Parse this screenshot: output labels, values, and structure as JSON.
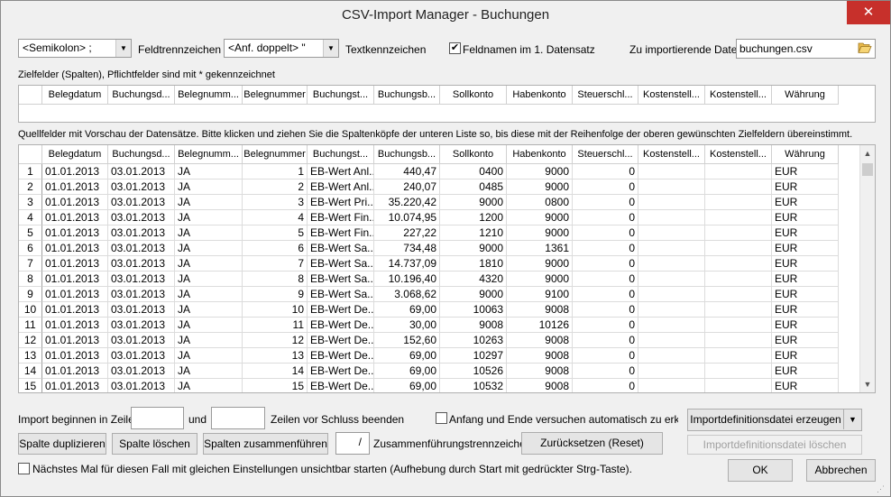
{
  "window": {
    "title": "CSV-Import Manager - Buchungen",
    "close_glyph": "✕"
  },
  "options": {
    "separator_value": "<Semikolon> ;",
    "separator_label": "Feldtrennzeichen",
    "text_value": "<Anf. doppelt> \"",
    "text_label": "Textkennzeichen",
    "fieldnames_checked": true,
    "fieldnames_label": "Feldnamen im 1. Datensatz",
    "file_label": "Zu importierende Datei:",
    "file_value": "buchungen.csv"
  },
  "target": {
    "caption": "Zielfelder (Spalten), Pflichtfelder sind mit * gekennzeichnet",
    "columns": [
      "",
      "Belegdatum",
      "Buchungsd...",
      "Belegnumm...",
      "Belegnummer",
      "Buchungst...",
      "Buchungsb...",
      "Sollkonto",
      "Habenkonto",
      "Steuerschl...",
      "Kostenstell...",
      "Kostenstell...",
      "Währung"
    ]
  },
  "source": {
    "caption": "Quellfelder mit Vorschau der Datensätze. Bitte klicken und ziehen Sie die Spaltenköpfe der unteren Liste so, bis diese mit der Reihenfolge der oberen gewünschten Zielfeldern übereinstimmt.",
    "columns": [
      "",
      "Belegdatum",
      "Buchungsd...",
      "Belegnumm...",
      "Belegnummer",
      "Buchungst...",
      "Buchungsb...",
      "Sollkonto",
      "Habenkonto",
      "Steuerschl...",
      "Kostenstell...",
      "Kostenstell...",
      "Währung"
    ],
    "rows": [
      [
        "1",
        "01.01.2013",
        "03.01.2013",
        "JA",
        "1",
        "EB-Wert Anl...",
        "440,47",
        "0400",
        "9000",
        "0",
        "",
        "",
        "EUR"
      ],
      [
        "2",
        "01.01.2013",
        "03.01.2013",
        "JA",
        "2",
        "EB-Wert Anl...",
        "240,07",
        "0485",
        "9000",
        "0",
        "",
        "",
        "EUR"
      ],
      [
        "3",
        "01.01.2013",
        "03.01.2013",
        "JA",
        "3",
        "EB-Wert Pri...",
        "35.220,42",
        "9000",
        "0800",
        "0",
        "",
        "",
        "EUR"
      ],
      [
        "4",
        "01.01.2013",
        "03.01.2013",
        "JA",
        "4",
        "EB-Wert Fin...",
        "10.074,95",
        "1200",
        "9000",
        "0",
        "",
        "",
        "EUR"
      ],
      [
        "5",
        "01.01.2013",
        "03.01.2013",
        "JA",
        "5",
        "EB-Wert Fin...",
        "227,22",
        "1210",
        "9000",
        "0",
        "",
        "",
        "EUR"
      ],
      [
        "6",
        "01.01.2013",
        "03.01.2013",
        "JA",
        "6",
        "EB-Wert Sa...",
        "734,48",
        "9000",
        "1361",
        "0",
        "",
        "",
        "EUR"
      ],
      [
        "7",
        "01.01.2013",
        "03.01.2013",
        "JA",
        "7",
        "EB-Wert Sa...",
        "14.737,09",
        "1810",
        "9000",
        "0",
        "",
        "",
        "EUR"
      ],
      [
        "8",
        "01.01.2013",
        "03.01.2013",
        "JA",
        "8",
        "EB-Wert Sa...",
        "10.196,40",
        "4320",
        "9000",
        "0",
        "",
        "",
        "EUR"
      ],
      [
        "9",
        "01.01.2013",
        "03.01.2013",
        "JA",
        "9",
        "EB-Wert Sa...",
        "3.068,62",
        "9000",
        "9100",
        "0",
        "",
        "",
        "EUR"
      ],
      [
        "10",
        "01.01.2013",
        "03.01.2013",
        "JA",
        "10",
        "EB-Wert De...",
        "69,00",
        "10063",
        "9008",
        "0",
        "",
        "",
        "EUR"
      ],
      [
        "11",
        "01.01.2013",
        "03.01.2013",
        "JA",
        "11",
        "EB-Wert De...",
        "30,00",
        "9008",
        "10126",
        "0",
        "",
        "",
        "EUR"
      ],
      [
        "12",
        "01.01.2013",
        "03.01.2013",
        "JA",
        "12",
        "EB-Wert De...",
        "152,60",
        "10263",
        "9008",
        "0",
        "",
        "",
        "EUR"
      ],
      [
        "13",
        "01.01.2013",
        "03.01.2013",
        "JA",
        "13",
        "EB-Wert De...",
        "69,00",
        "10297",
        "9008",
        "0",
        "",
        "",
        "EUR"
      ],
      [
        "14",
        "01.01.2013",
        "03.01.2013",
        "JA",
        "14",
        "EB-Wert De...",
        "69,00",
        "10526",
        "9008",
        "0",
        "",
        "",
        "EUR"
      ],
      [
        "15",
        "01.01.2013",
        "03.01.2013",
        "JA",
        "15",
        "EB-Wert De...",
        "69,00",
        "10532",
        "9008",
        "0",
        "",
        "",
        "EUR"
      ]
    ]
  },
  "import": {
    "start_label": "Import beginnen in Zeile:",
    "start_value": "",
    "und_label": "und",
    "end_value": "",
    "end_label": "Zeilen vor Schluss beenden",
    "auto_checked": false,
    "auto_label": "Anfang und Ende versuchen automatisch zu erkennen"
  },
  "buttons": {
    "create_def": "Importdefinitionsdatei erzeugen",
    "delete_def": "Importdefinitionsdatei löschen",
    "duplicate": "Spalte duplizieren",
    "delete_col": "Spalte löschen",
    "merge": "Spalten zusammenführen",
    "merge_sep_value": "/",
    "merge_sep_label": "Zusammenführungstrennzeichen",
    "reset": "Zurücksetzen (Reset)",
    "ok": "OK",
    "cancel": "Abbrechen"
  },
  "footer": {
    "invisible_checked": false,
    "invisible_label": "Nächstes Mal für diesen Fall mit gleichen Einstellungen unsichtbar starten (Aufhebung durch Start mit gedrückter Strg-Taste)."
  },
  "icons": {
    "folder": "folder-open-icon",
    "dropdown": "chevron-down-icon",
    "check": "✔"
  }
}
